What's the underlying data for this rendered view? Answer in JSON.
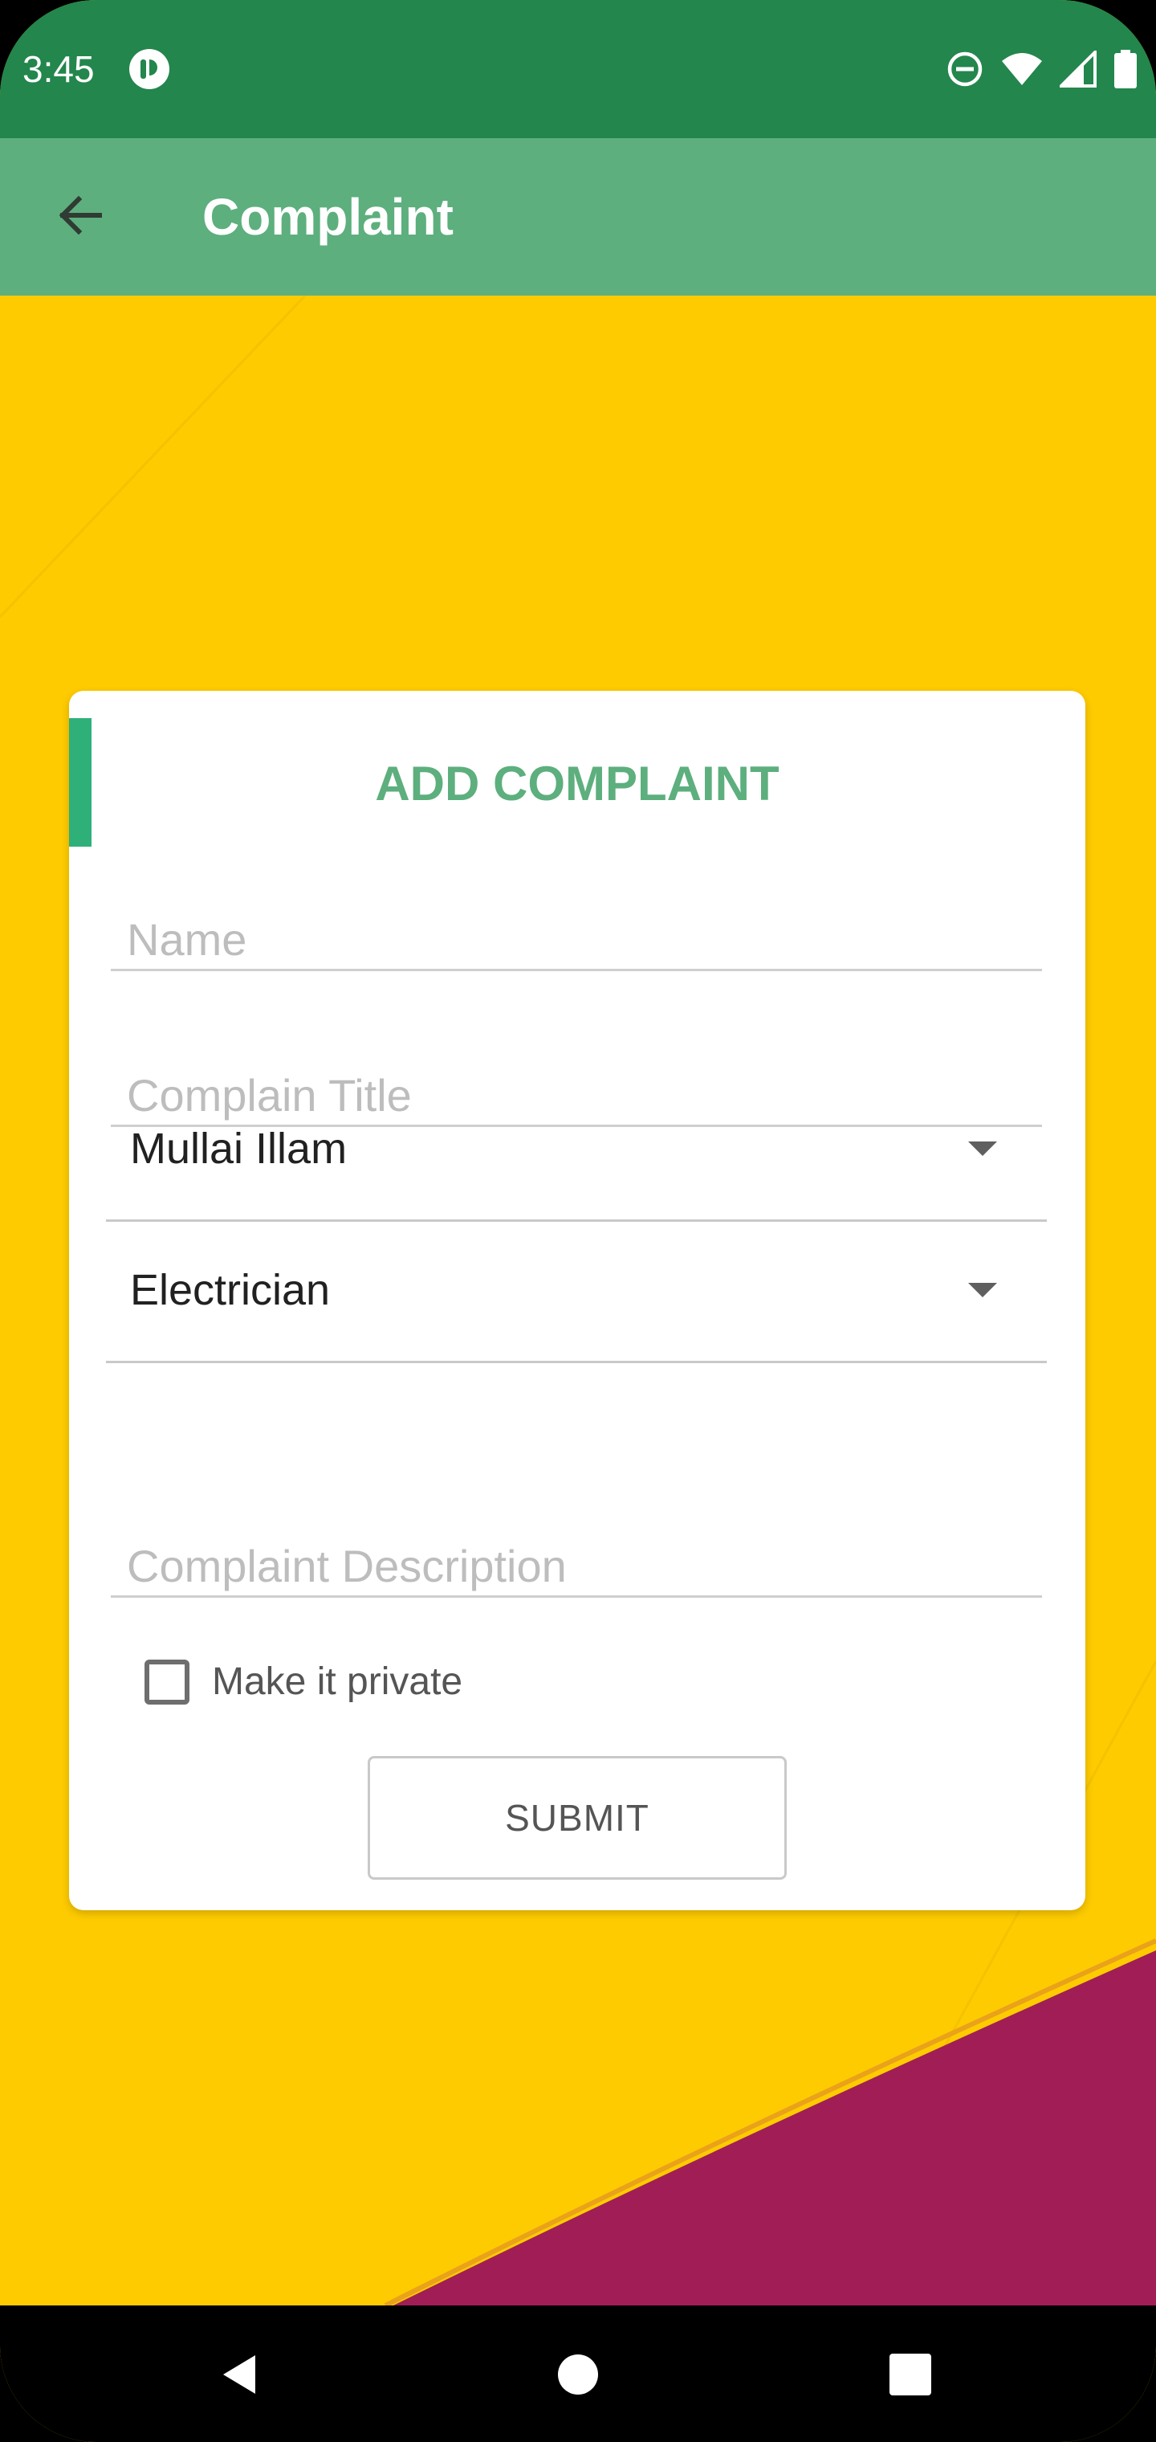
{
  "status_bar": {
    "time": "3:45",
    "icons": [
      "app-notification-icon",
      "do-not-disturb-icon",
      "wifi-icon",
      "cellular-signal-icon",
      "battery-icon"
    ]
  },
  "app_bar": {
    "title": "Complaint",
    "back_icon": "arrow-back-icon"
  },
  "colors": {
    "status_bar": "#23864C",
    "app_bar": "#5DAF7E",
    "background": "#FECB00",
    "accent_decor": "#A01E55",
    "card_accent": "#2FB079",
    "card_title": "#5DAF7E"
  },
  "form": {
    "title": "ADD COMPLAINT",
    "name_placeholder": "Name",
    "name_value": "",
    "title_placeholder": "Complain Title",
    "title_value": "",
    "location_selected": "Mullai Illam",
    "category_selected": "Electrician",
    "description_placeholder": "Complaint Description",
    "description_value": "",
    "private_label": "Make it private",
    "private_checked": false,
    "submit_label": "SUBMIT"
  },
  "nav_bar": {
    "buttons": [
      "back-triangle-icon",
      "home-circle-icon",
      "recents-square-icon"
    ]
  }
}
